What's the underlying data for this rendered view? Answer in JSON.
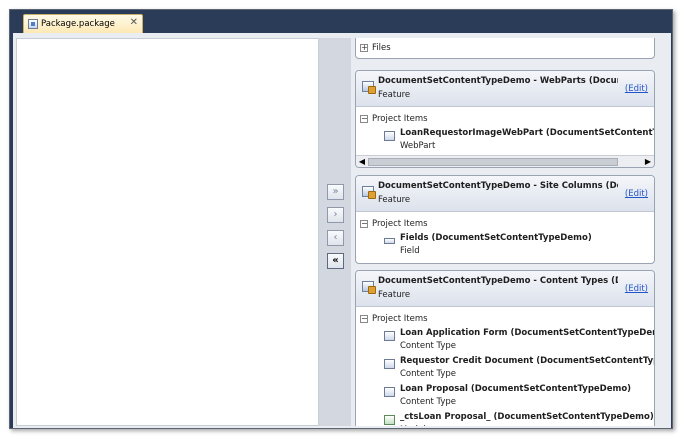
{
  "tab": {
    "label": "Package.package",
    "close": "✕"
  },
  "nav_buttons": [
    {
      "glyph": "»",
      "name": "add-all-button"
    },
    {
      "glyph": "›",
      "name": "add-button"
    },
    {
      "glyph": "‹",
      "name": "remove-button"
    },
    {
      "glyph": "«",
      "name": "remove-all-button"
    }
  ],
  "files_section": {
    "expander": "+",
    "label": "Files"
  },
  "cards": [
    {
      "title": "DocumentSetContentTypeDemo - WebParts (Document...",
      "subtitle": "Feature",
      "edit": "(Edit)",
      "section": "Project Items",
      "expander": "−",
      "items": [
        {
          "name": "LoanRequestorImageWebPart (DocumentSetContentTypeDe",
          "type": "WebPart"
        }
      ]
    },
    {
      "title": "DocumentSetContentTypeDemo - Site Columns (Docume...",
      "subtitle": "Feature",
      "edit": "(Edit)",
      "section": "Project Items",
      "expander": "−",
      "items": [
        {
          "name": "Fields (DocumentSetContentTypeDemo)",
          "type": "Field"
        }
      ]
    },
    {
      "title": "DocumentSetContentTypeDemo - Content Types (Docu...",
      "subtitle": "Feature",
      "edit": "(Edit)",
      "section": "Project Items",
      "expander": "−",
      "items": [
        {
          "name": "Loan Application Form (DocumentSetContentTypeDemo)",
          "type": "Content Type"
        },
        {
          "name": "Requestor Credit Document (DocumentSetContentTypeDem",
          "type": "Content Type"
        },
        {
          "name": "Loan Proposal (DocumentSetContentTypeDemo)",
          "type": "Content Type"
        },
        {
          "name": "_ctsLoan Proposal_ (DocumentSetContentTypeDemo)",
          "type": "Module"
        }
      ]
    }
  ],
  "scrollbar": {
    "left": "◀",
    "right": "▶"
  },
  "colors": {
    "frame": "#2b3c59",
    "tab": "#fde9b4",
    "link": "#2255cc"
  }
}
